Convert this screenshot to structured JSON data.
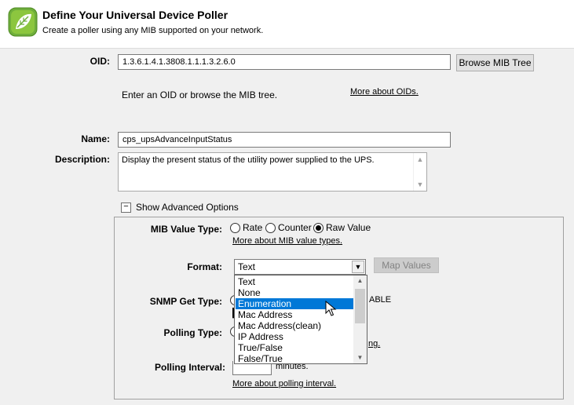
{
  "header": {
    "title": "Define Your Universal Device Poller",
    "subtitle": "Create a poller using any MIB supported on your network."
  },
  "oid": {
    "label": "OID:",
    "value": "1.3.6.1.4.1.3808.1.1.1.3.2.6.0",
    "browse_button": "Browse MIB Tree",
    "hint": "Enter an OID or browse the MIB tree.",
    "more_link": "More about OIDs."
  },
  "name": {
    "label": "Name:",
    "value": "cps_upsAdvanceInputStatus"
  },
  "description": {
    "label": "Description:",
    "value": "Display the present status of the utility power supplied to the UPS."
  },
  "advanced": {
    "toggle_symbol": "−",
    "toggle_label": "Show Advanced Options",
    "mib_value_type": {
      "label": "MIB Value Type:",
      "options": [
        "Rate",
        "Counter",
        "Raw Value"
      ],
      "selected": "Raw Value",
      "more_link": "More about MIB value types."
    },
    "format": {
      "label": "Format:",
      "value": "Text",
      "map_values_button": "Map Values",
      "options": [
        "Text",
        "None",
        "Enumeration",
        "Mac Address",
        "Mac Address(clean)",
        "IP Address",
        "True/False",
        "False/True"
      ],
      "highlighted": "Enumeration"
    },
    "snmp_get_type": {
      "label": "SNMP Get Type:",
      "partial_text": "ABLE"
    },
    "polling_type": {
      "label": "Polling Type:",
      "partial_link": "ng."
    },
    "polling_interval": {
      "label": "Polling Interval:",
      "unit": "minutes.",
      "more_link": "More about polling interval."
    }
  }
}
